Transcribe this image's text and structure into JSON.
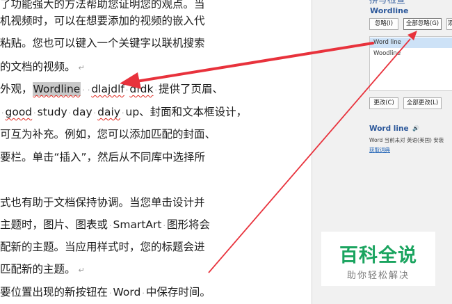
{
  "document": {
    "lines": [
      {
        "text": "了功能强大的方法帮助您证明您的观点。当"
      },
      {
        "text": "机视频时，可以在想要添加的视频的嵌入代"
      },
      {
        "text": "粘贴。您也可以键入一个关键字以联机搜索"
      },
      {
        "text": "的文档的视频。"
      },
      {
        "prefix": "外观，",
        "selected": "Wordline",
        "mid": "dlajdlf",
        "mid2": "dfdk",
        "suffix": "提供了页眉、"
      },
      {
        "words": [
          "good",
          "study",
          "day",
          "daiy",
          "up"
        ],
        "suffix": "、封面和文本框设计，"
      },
      {
        "text": "可互为补充。例如，您可以添加匹配的封面、"
      },
      {
        "text": "要栏。单击“插入”，然后从不同库中选择所"
      },
      {
        "text": ""
      },
      {
        "text": "式也有助于文档保持协调。当您单击设计并"
      },
      {
        "prefix": "主题时，图片、图表或",
        "brand": "SmartArt",
        "suffix": "图形将会"
      },
      {
        "text": "配新的主题。当应用样式时，您的标题会进"
      },
      {
        "text": "匹配新的主题。"
      },
      {
        "prefix": "要位置出现的新按钮在",
        "brand": "Word",
        "suffix": "中保存时间。"
      }
    ]
  },
  "pane": {
    "title": "拼写检查",
    "word": "Wordline",
    "ignore_label": "忽略(I)",
    "ignore_all_label": "全部忽略(G)",
    "add_label": "添",
    "suggestions": [
      "Word line",
      "Woodline"
    ],
    "change_label": "更改(C)",
    "change_all_label": "全部更改(L)",
    "definition_word": "Word line",
    "definition_text": "Word 当前未对 英语(美国) 安装",
    "definition_link": "获取词典"
  },
  "watermark": {
    "title": "百科全说",
    "subtitle": "助你轻松解决"
  },
  "colors": {
    "accent": "#2b579a",
    "arrow": "#e8323c",
    "watermark_green": "#1aa45f"
  }
}
